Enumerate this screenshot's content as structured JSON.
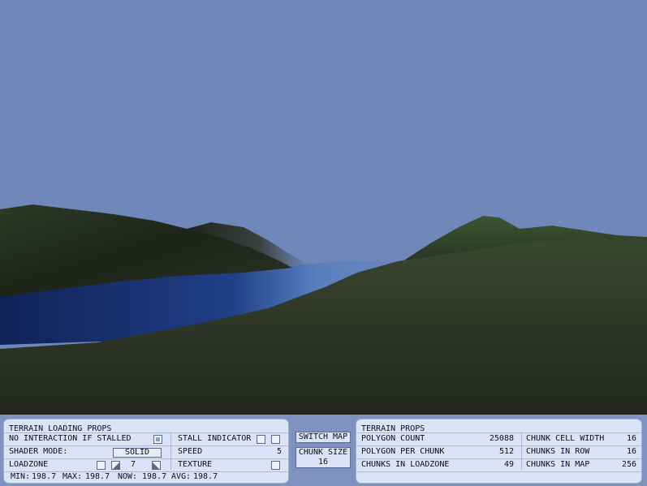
{
  "colors": {
    "sky": "#6f88b9",
    "water": "#14265e",
    "terrain": "#2f3a27",
    "hud_bg": "#7e93bf",
    "panel_bg": "#dbe4f6"
  },
  "loading_panel": {
    "title": "TERRAIN LOADING PROPS",
    "no_interaction_label": "NO INTERACTION IF STALLED",
    "no_interaction_checked": true,
    "shader_mode_label": "SHADER MODE:",
    "shader_mode_value": "SOLID",
    "loadzone_label": "LOADZONE",
    "loadzone_value": "7",
    "stall_indicator_label": "STALL INDICATOR",
    "speed_label": "SPEED",
    "speed_value": "5",
    "texture_label": "TEXTURE",
    "stats": {
      "min_label": "MIN:",
      "min_value": "198.7",
      "max_label": "MAX:",
      "max_value": "198.7",
      "now_label": "NOW:",
      "now_value": "198.7",
      "avg_label": "AVG:",
      "avg_value": "198.7"
    }
  },
  "middle": {
    "switch_map_label": "SWITCH MAP",
    "chunk_size_label": "CHUNK SIZE",
    "chunk_size_value": "16"
  },
  "props_panel": {
    "title": "TERRAIN PROPS",
    "polygon_count_label": "POLYGON COUNT",
    "polygon_count_value": "25088",
    "polygon_per_chunk_label": "POLYGON PER CHUNK",
    "polygon_per_chunk_value": "512",
    "chunks_in_loadzone_label": "CHUNKS IN LOADZONE",
    "chunks_in_loadzone_value": "49",
    "chunk_cell_width_label": "CHUNK CELL WIDTH",
    "chunk_cell_width_value": "16",
    "chunks_in_row_label": "CHUNKS IN ROW",
    "chunks_in_row_value": "16",
    "chunks_in_map_label": "CHUNKS IN MAP",
    "chunks_in_map_value": "256"
  }
}
